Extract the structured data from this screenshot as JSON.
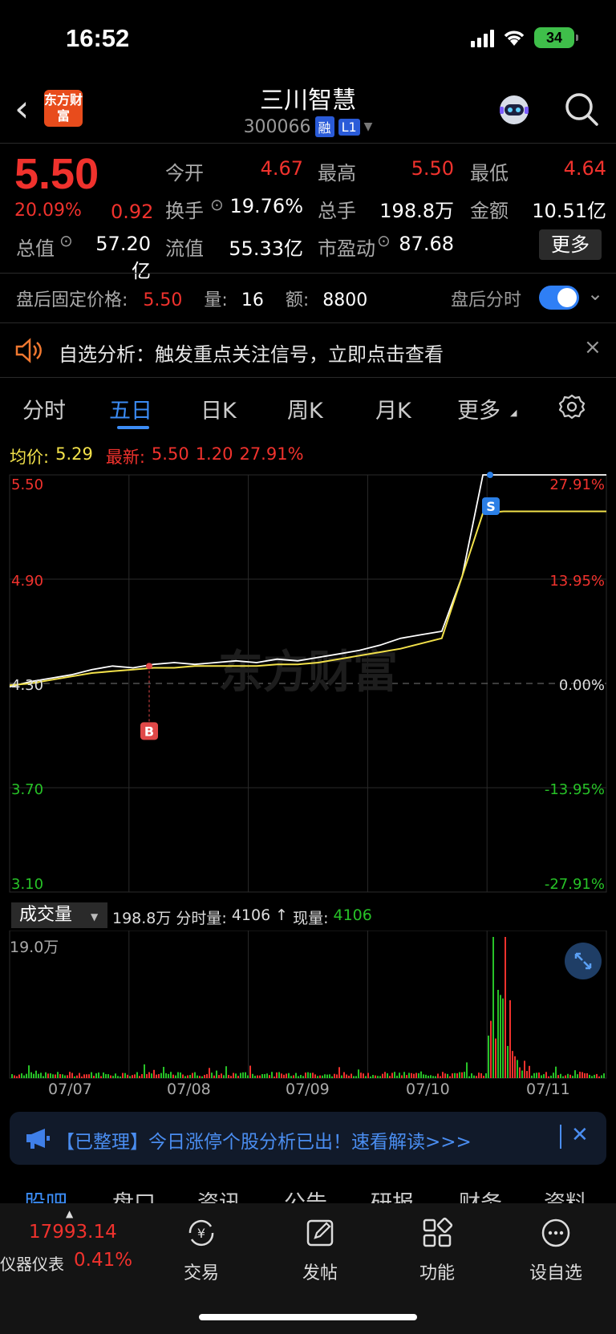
{
  "status": {
    "time": "16:52",
    "battery": "34"
  },
  "header": {
    "name": "三川智慧",
    "code": "300066",
    "tag_margin": "融",
    "tag_level": "L1",
    "logo_text": "东方财富"
  },
  "quote": {
    "price": "5.50",
    "pct": "20.09%",
    "change": "0.92",
    "rows": [
      [
        {
          "l": "今开",
          "v": "4.67",
          "c": "red"
        },
        {
          "l": "最高",
          "v": "5.50",
          "c": "red"
        },
        {
          "l": "最低",
          "v": "4.64",
          "c": "red"
        }
      ],
      [
        {
          "l": "换手",
          "v": "19.76%",
          "c": "white"
        },
        {
          "l": "总手",
          "v": "198.8万",
          "c": "white"
        },
        {
          "l": "金额",
          "v": "10.51亿",
          "c": "white"
        }
      ],
      [
        {
          "l": "总值",
          "v": "57.20亿",
          "c": "white"
        },
        {
          "l": "流值",
          "v": "55.33亿",
          "c": "white"
        },
        {
          "l": "市盈动",
          "v": "87.68",
          "c": "white"
        }
      ]
    ],
    "more": "更多"
  },
  "after_hours": {
    "label": "盘后固定价格:",
    "price": "5.50",
    "vol_label": "量:",
    "vol": "16",
    "amt_label": "额:",
    "amt": "8800",
    "toggle_label": "盘后分时"
  },
  "alert": {
    "text": "自选分析：触发重点关注信号，立即点击查看"
  },
  "tabs": [
    "分时",
    "五日",
    "日K",
    "周K",
    "月K",
    "更多"
  ],
  "active_tab": "五日",
  "legend": {
    "avg_label": "均价:",
    "avg": "5.29",
    "last_label": "最新:",
    "last": "5.50",
    "chg": "1.20",
    "pct": "27.91%"
  },
  "chart_data": {
    "type": "line",
    "title": "",
    "x": [
      "07/07",
      "07/08",
      "07/09",
      "07/10",
      "07/11"
    ],
    "y_ticks": [
      "5.50",
      "4.90",
      "4.30",
      "3.70",
      "3.10"
    ],
    "y_pct_ticks": [
      "27.91%",
      "13.95%",
      "0.00%",
      "-13.95%",
      "-27.91%"
    ],
    "ylim": [
      3.1,
      5.5
    ],
    "base": 4.3,
    "series": [
      {
        "name": "最新",
        "values": [
          4.28,
          4.31,
          4.33,
          4.35,
          4.38,
          4.4,
          4.39,
          4.41,
          4.42,
          4.41,
          4.42,
          4.43,
          4.42,
          4.44,
          4.43,
          4.45,
          4.47,
          4.49,
          4.52,
          4.56,
          4.58,
          4.6,
          4.92,
          5.5,
          5.5,
          5.5,
          5.5,
          5.5,
          5.5,
          5.5
        ]
      },
      {
        "name": "均价",
        "values": [
          4.29,
          4.3,
          4.32,
          4.34,
          4.36,
          4.37,
          4.38,
          4.39,
          4.39,
          4.4,
          4.4,
          4.4,
          4.4,
          4.41,
          4.41,
          4.42,
          4.44,
          4.46,
          4.48,
          4.5,
          4.53,
          4.56,
          null,
          5.28,
          5.29,
          5.29,
          5.29,
          5.29,
          5.29,
          5.29
        ]
      }
    ],
    "markers": [
      {
        "label": "B",
        "value": 4.4
      },
      {
        "label": "S",
        "value": 5.32
      }
    ],
    "volume_max": "19.0万"
  },
  "volume": {
    "selector": "成交量",
    "total": "198.8万",
    "period_label": "分时量:",
    "period": "4106",
    "now_label": "现量:",
    "now": "4106"
  },
  "watermark": "东方财富",
  "notice": {
    "text": "【已整理】今日涨停个股分析已出！速看解读>>>"
  },
  "lower_tabs": [
    "股吧",
    "盘口",
    "资讯",
    "公告",
    "研报",
    "财务",
    "资料"
  ],
  "bottom": {
    "index_value": "17993.14",
    "index_name": "仪器仪表",
    "index_pct": "0.41%",
    "items": [
      "交易",
      "发帖",
      "功能",
      "设自选"
    ]
  },
  "colors": {
    "up": "#f0322d",
    "down": "#27c227",
    "accent": "#3b8cf5",
    "avg": "#f2e14a"
  }
}
